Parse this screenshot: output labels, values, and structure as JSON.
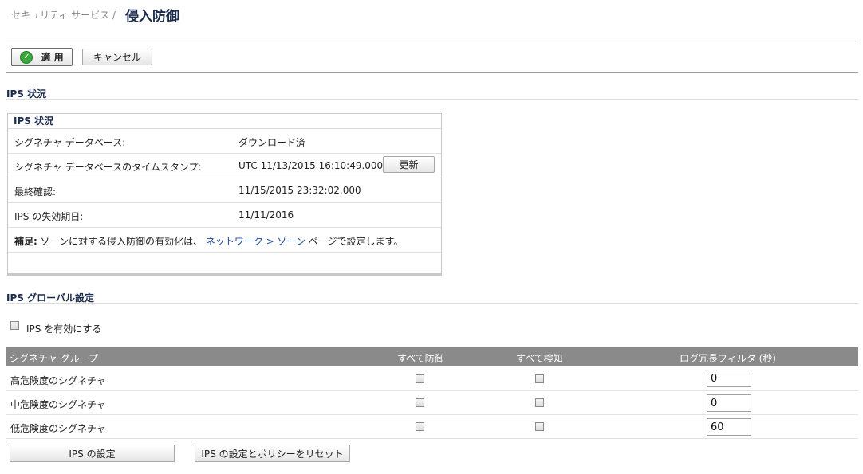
{
  "header": {
    "breadcrumb": "セキュリティ サービス /",
    "title": "侵入防御"
  },
  "toolbar": {
    "apply_label": "適 用",
    "cancel_label": "キャンセル"
  },
  "ips_status_section": {
    "title": "IPS 状況",
    "box_title": "IPS 状況",
    "rows": [
      {
        "label": "シグネチャ データベース:",
        "value": "ダウンロード済"
      },
      {
        "label": "シグネチャ データベースのタイムスタンプ:",
        "value": "UTC 11/13/2015 16:10:49.000"
      },
      {
        "label": "最終確認:",
        "value": "11/15/2015 23:32:02.000"
      },
      {
        "label": "IPS の失効期日:",
        "value": "11/11/2016"
      }
    ],
    "refresh_label": "更新",
    "note_prefix": "補足:",
    "note_text": " ゾーンに対する侵入防御の有効化は、",
    "note_link": "ネットワーク > ゾーン",
    "note_suffix": " ページで設定します。"
  },
  "global_settings": {
    "title": "IPS グローバル設定",
    "enable_label": "IPS を有効にする",
    "enable_checked": false
  },
  "signature_groups": {
    "columns": [
      "シグネチャ グループ",
      "すべて防御",
      "すべて検知",
      "ログ冗長フィルタ (秒)"
    ],
    "rows": [
      {
        "name": "高危険度のシグネチャ",
        "prevent_all": false,
        "detect_all": false,
        "log_filter": "0"
      },
      {
        "name": "中危険度のシグネチャ",
        "prevent_all": false,
        "detect_all": false,
        "log_filter": "0"
      },
      {
        "name": "低危険度のシグネチャ",
        "prevent_all": false,
        "detect_all": false,
        "log_filter": "60"
      }
    ]
  },
  "bottom_buttons": {
    "ips_settings_label": "IPS の設定",
    "reset_label": "IPS の設定とポリシーをリセット"
  },
  "colors": {
    "header_bar": "#8a8a8a",
    "link": "#1a4aa0",
    "apply_icon": "#3aa83a"
  }
}
